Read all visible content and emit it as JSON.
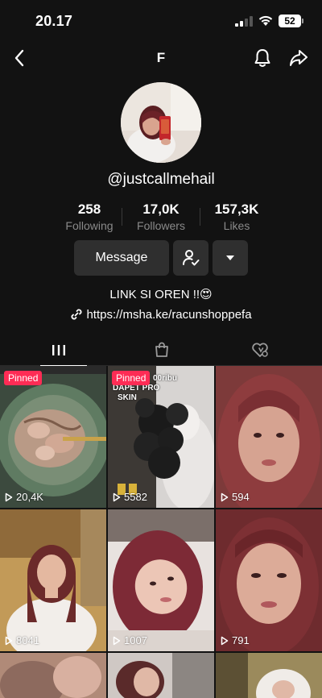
{
  "status": {
    "time": "20.17",
    "battery": "52"
  },
  "nav": {
    "title": "F"
  },
  "profile": {
    "username": "@justcallmehail",
    "stats": [
      {
        "value": "258",
        "label": "Following"
      },
      {
        "value": "17,0K",
        "label": "Followers"
      },
      {
        "value": "157,3K",
        "label": "Likes"
      }
    ],
    "message_label": "Message",
    "bio": "LINK SI OREN !!😍",
    "link": "https://msha.ke/racunshoppefa"
  },
  "tabs": [
    {
      "icon": "grid-icon",
      "active": true
    },
    {
      "icon": "bag-icon",
      "active": false
    },
    {
      "icon": "liked-heart-icon",
      "active": false
    }
  ],
  "videos": [
    {
      "views": "20,4K",
      "pinned": "Pinned"
    },
    {
      "views": "5582",
      "pinned": "Pinned",
      "overlay_lines": [
        "00ribu",
        "DAPET PRO",
        "SKIN"
      ]
    },
    {
      "views": "594"
    },
    {
      "views": "8041"
    },
    {
      "views": "1007"
    },
    {
      "views": "791"
    }
  ]
}
